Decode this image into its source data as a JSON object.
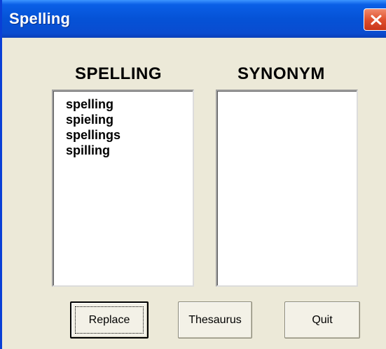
{
  "window": {
    "title": "Spelling"
  },
  "spelling": {
    "header": "SPELLING",
    "items": [
      "spelling",
      "spieling",
      "spellings",
      "spilling"
    ]
  },
  "synonym": {
    "header": "SYNONYM",
    "items": []
  },
  "buttons": {
    "replace": "Replace",
    "thesaurus": "Thesaurus",
    "quit": "Quit"
  },
  "colors": {
    "titlebar": "#0552d6",
    "dialog_bg": "#ece9d8",
    "close_button": "#e0502e"
  }
}
